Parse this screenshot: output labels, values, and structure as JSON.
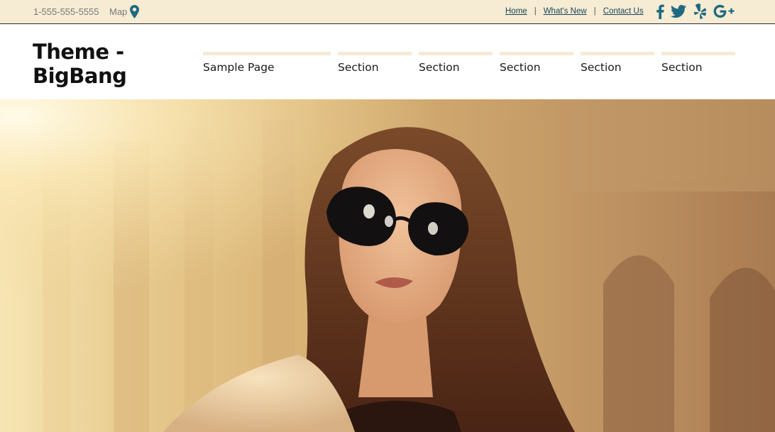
{
  "topbar": {
    "phone": "1-555-555-5555",
    "map_label": "Map",
    "map_icon": "map-pin-icon",
    "links": [
      "Home",
      "What's New",
      "Contact Us"
    ],
    "separator": "|",
    "social": [
      "facebook-icon",
      "twitter-icon",
      "yelp-icon",
      "google-plus-icon"
    ],
    "background_color": "#f6ebd3",
    "link_color": "#17475a"
  },
  "header": {
    "title": "Theme - BigBang",
    "nav": [
      "Sample Page",
      "Section",
      "Section",
      "Section",
      "Section",
      "Section"
    ],
    "nav_bar_color": "#f4ebd5"
  },
  "hero": {
    "image": "hero-photo-woman-sunglasses"
  }
}
